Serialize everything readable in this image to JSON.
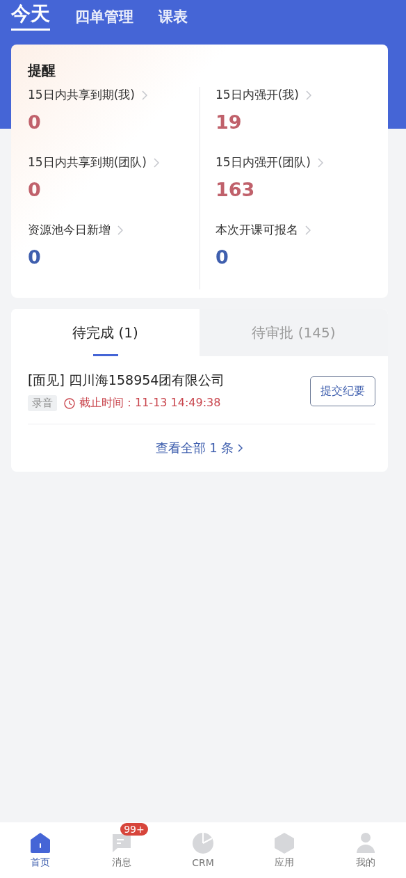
{
  "top_tabs": [
    {
      "label": "今天",
      "selected": true
    },
    {
      "label": "四单管理",
      "selected": false
    },
    {
      "label": "课表",
      "selected": false
    }
  ],
  "reminders": {
    "title": "提醒",
    "items": [
      {
        "label": "15日内共享到期(我)",
        "value": "0",
        "color": "#c0616b"
      },
      {
        "label": "15日内强开(我)",
        "value": "19",
        "color": "#c0616b"
      },
      {
        "label": "15日内共享到期(团队)",
        "value": "0",
        "color": "#c0616b"
      },
      {
        "label": "15日内强开(团队)",
        "value": "163",
        "color": "#c0616b"
      },
      {
        "label": "资源池今日新增",
        "value": "0",
        "color": "#3f5fae"
      },
      {
        "label": "本次开课可报名",
        "value": "0",
        "color": "#3f5fae"
      }
    ]
  },
  "tasks": {
    "tabs": [
      {
        "label": "待完成 (1)",
        "selected": true
      },
      {
        "label": "待审批 (145)",
        "selected": false
      }
    ],
    "items": [
      {
        "title": "[面见] 四川海158954团有限公司",
        "tag": "录音",
        "deadline": "截止时间：11-13 14:49:38",
        "action": "提交纪要"
      }
    ],
    "view_all": "查看全部 1 条"
  },
  "bottom_nav": [
    {
      "kind": "home",
      "label": "首页",
      "selected": true
    },
    {
      "kind": "message",
      "label": "消息",
      "badge": "99+",
      "selected": false
    },
    {
      "kind": "crm",
      "label": "CRM",
      "selected": false
    },
    {
      "kind": "apps",
      "label": "应用",
      "selected": false
    },
    {
      "kind": "me",
      "label": "我的",
      "selected": false
    }
  ]
}
